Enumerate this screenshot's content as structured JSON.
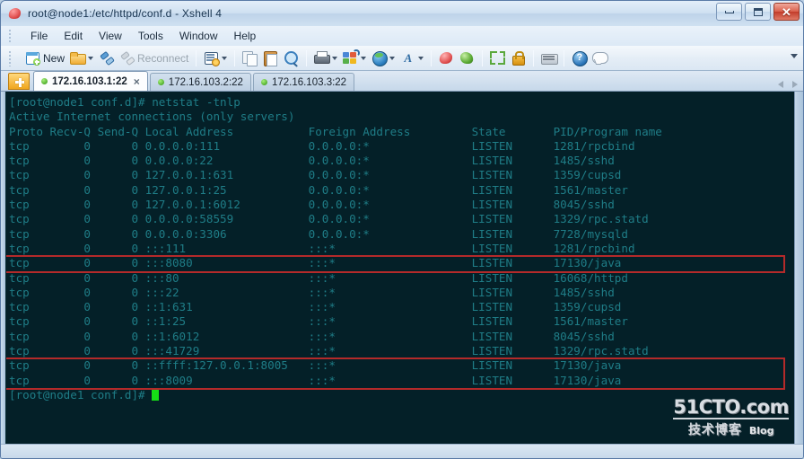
{
  "window": {
    "title": "root@node1:/etc/httpd/conf.d - Xshell 4",
    "icon": "xshell-logo-icon",
    "minimize_label": "–",
    "maximize_label": "□",
    "close_label": "✕"
  },
  "menu": {
    "items": [
      {
        "label": "File",
        "name": "menu-file"
      },
      {
        "label": "Edit",
        "name": "menu-edit"
      },
      {
        "label": "View",
        "name": "menu-view"
      },
      {
        "label": "Tools",
        "name": "menu-tools"
      },
      {
        "label": "Window",
        "name": "menu-window"
      },
      {
        "label": "Help",
        "name": "menu-help"
      }
    ]
  },
  "toolbar": {
    "new_label": "New",
    "reconnect_label": "Reconnect",
    "buttons": [
      {
        "name": "new-session-button",
        "icon": "new-session-icon",
        "label": "New",
        "enabled": true
      },
      {
        "name": "open-session-button",
        "icon": "folder-open-icon",
        "has_caret": true,
        "enabled": true
      },
      {
        "name": "connect-button",
        "icon": "plug-connect-icon",
        "enabled": true
      },
      {
        "name": "reconnect-button",
        "icon": "plug-reconnect-icon",
        "label": "Reconnect",
        "enabled": false
      },
      {
        "name": "properties-button",
        "icon": "properties-gear-icon",
        "has_caret": true,
        "enabled": true
      },
      {
        "name": "copy-button",
        "icon": "copy-icon",
        "enabled": false
      },
      {
        "name": "paste-button",
        "icon": "paste-icon",
        "enabled": true
      },
      {
        "name": "find-button",
        "icon": "find-magnifier-icon",
        "enabled": true
      },
      {
        "name": "print-button",
        "icon": "printer-icon",
        "has_caret": true,
        "enabled": true
      },
      {
        "name": "layout-button",
        "icon": "layout-arrange-icon",
        "has_caret": true,
        "enabled": true
      },
      {
        "name": "transfer-button",
        "icon": "globe-icon",
        "has_caret": true,
        "enabled": true
      },
      {
        "name": "font-button",
        "icon": "font-icon",
        "glyph": "A",
        "has_caret": true,
        "enabled": true
      },
      {
        "name": "xshell-button",
        "icon": "xshell-icon",
        "enabled": true
      },
      {
        "name": "xftp-button",
        "icon": "xftp-icon",
        "enabled": true
      },
      {
        "name": "fullscreen-button",
        "icon": "fullscreen-icon",
        "enabled": true
      },
      {
        "name": "lock-button",
        "icon": "lock-icon",
        "enabled": true
      },
      {
        "name": "keyboard-button",
        "icon": "keyboard-icon",
        "enabled": true
      },
      {
        "name": "help-button",
        "icon": "help-question-icon",
        "glyph": "?",
        "enabled": true
      },
      {
        "name": "chat-button",
        "icon": "chat-bubble-icon",
        "enabled": true
      }
    ],
    "overflow_name": "toolbar-overflow-chevron-icon"
  },
  "tabs": {
    "add_label": "+",
    "items": [
      {
        "label": "172.16.103.1:22",
        "active": true,
        "close_label": "×"
      },
      {
        "label": "172.16.103.2:22",
        "active": false,
        "close_label": ""
      },
      {
        "label": "172.16.103.3:22",
        "active": false,
        "close_label": ""
      }
    ]
  },
  "terminal": {
    "background_color": "#042028",
    "text_color": "#1f7d87",
    "cursor_color": "#16e016",
    "highlight_color": "#b42a2a",
    "prompt": "[root@node1 conf.d]#",
    "command": "netstat -tnlp",
    "header_line": "Active Internet connections (only servers)",
    "columns": [
      "Proto",
      "Recv-Q",
      "Send-Q",
      "Local Address",
      "Foreign Address",
      "State",
      "PID/Program name"
    ],
    "lines": [
      "[root@node1 conf.d]# netstat -tnlp",
      "Active Internet connections (only servers)",
      "Proto Recv-Q Send-Q Local Address           Foreign Address         State       PID/Program name",
      "tcp        0      0 0.0.0.0:111             0.0.0.0:*               LISTEN      1281/rpcbind",
      "tcp        0      0 0.0.0.0:22              0.0.0.0:*               LISTEN      1485/sshd",
      "tcp        0      0 127.0.0.1:631           0.0.0.0:*               LISTEN      1359/cupsd",
      "tcp        0      0 127.0.0.1:25            0.0.0.0:*               LISTEN      1561/master",
      "tcp        0      0 127.0.0.1:6012          0.0.0.0:*               LISTEN      8045/sshd",
      "tcp        0      0 0.0.0.0:58559           0.0.0.0:*               LISTEN      1329/rpc.statd",
      "tcp        0      0 0.0.0.0:3306            0.0.0.0:*               LISTEN      7728/mysqld",
      "tcp        0      0 :::111                  :::*                    LISTEN      1281/rpcbind",
      "tcp        0      0 :::8080                 :::*                    LISTEN      17130/java",
      "tcp        0      0 :::80                   :::*                    LISTEN      16068/httpd",
      "tcp        0      0 :::22                   :::*                    LISTEN      1485/sshd",
      "tcp        0      0 ::1:631                 :::*                    LISTEN      1359/cupsd",
      "tcp        0      0 ::1:25                  :::*                    LISTEN      1561/master",
      "tcp        0      0 ::1:6012                :::*                    LISTEN      8045/sshd",
      "tcp        0      0 :::41729                :::*                    LISTEN      1329/rpc.statd",
      "tcp        0      0 ::ffff:127.0.0.1:8005   :::*                    LISTEN      17130/java",
      "tcp        0      0 :::8009                 :::*                    LISTEN      17130/java",
      "[root@node1 conf.d]# "
    ],
    "highlights": [
      {
        "name": "highlight-port-8080",
        "line_index": 11,
        "line_span": 1
      },
      {
        "name": "highlight-ports-8005-8009",
        "line_index": 18,
        "line_span": 2
      }
    ]
  },
  "watermark": {
    "main": "51CTO.com",
    "cn": "技术博客",
    "blog": "Blog"
  }
}
